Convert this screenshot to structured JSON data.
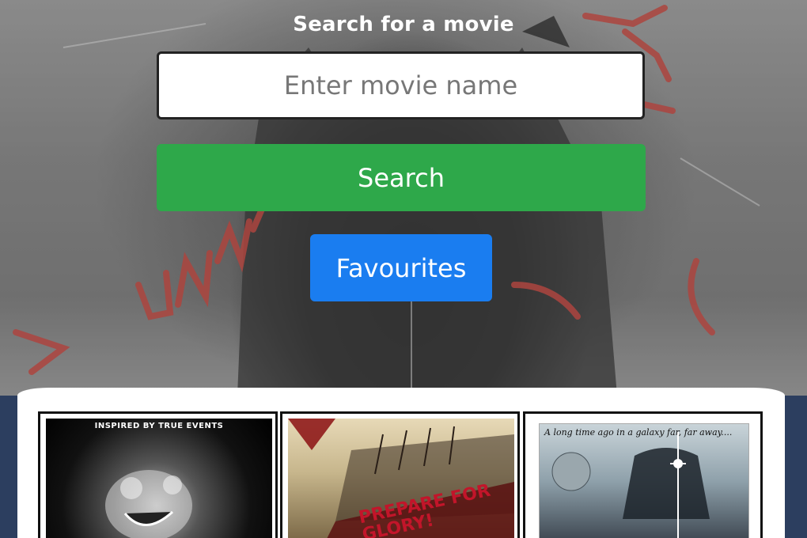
{
  "hero": {
    "title": "Search for a movie",
    "search": {
      "placeholder": "Enter movie name",
      "value": ""
    },
    "search_button": "Search",
    "favourites_button": "Favourites"
  },
  "results": {
    "cards": [
      {
        "poster_text": "INSPIRED BY TRUE EVENTS"
      },
      {
        "poster_text": "PREPARE FOR GLORY!"
      },
      {
        "poster_text": "A long time ago in a galaxy far, far away...."
      }
    ]
  },
  "colors": {
    "search_button": "#2ea84a",
    "favourites_button": "#1a7df0",
    "page_background": "#2c3e5f"
  }
}
